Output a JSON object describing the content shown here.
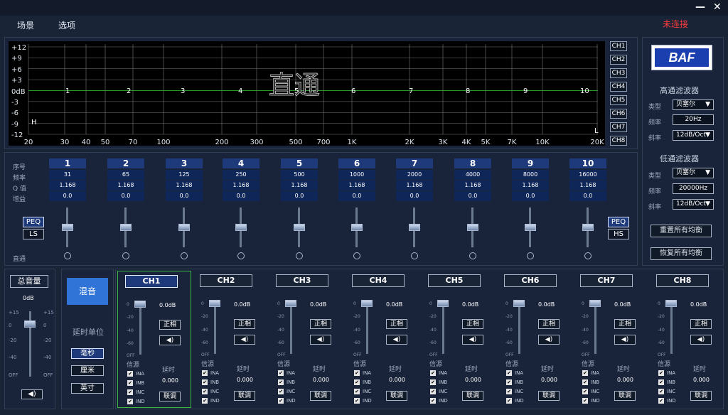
{
  "menu": {
    "items": [
      "场景",
      "选项"
    ],
    "status": "未连接",
    "minimize": "—",
    "close": "✕"
  },
  "graph": {
    "ylabels": [
      "+12",
      "+9",
      "+6",
      "+3",
      "0dB",
      "-3",
      "-6",
      "-9",
      "-12"
    ],
    "xlabels": [
      "20",
      "30",
      "40",
      "50",
      "70",
      "100",
      "200",
      "300",
      "500",
      "700",
      "1K",
      "2K",
      "3K",
      "4K",
      "5K",
      "7K",
      "10K",
      "20K"
    ],
    "band_marks": [
      "1",
      "2",
      "3",
      "4",
      "5",
      "6",
      "7",
      "8",
      "9",
      "10"
    ],
    "overlay": "直通",
    "h_mark": "H",
    "l_mark": "L"
  },
  "channel_tabs": [
    "CH1",
    "CH2",
    "CH3",
    "CH4",
    "CH5",
    "CH6",
    "CH7",
    "CH8"
  ],
  "peq": {
    "row_labels": [
      "序号",
      "频率",
      "Q 值",
      "增益"
    ],
    "bypass_label": "直通",
    "left_buttons": [
      "PEQ",
      "LS"
    ],
    "right_buttons": [
      "PEQ",
      "HS"
    ],
    "bands": [
      {
        "n": "1",
        "freq": "31",
        "q": "1.168",
        "gain": "0.0"
      },
      {
        "n": "2",
        "freq": "65",
        "q": "1.168",
        "gain": "0.0"
      },
      {
        "n": "3",
        "freq": "125",
        "q": "1.168",
        "gain": "0.0"
      },
      {
        "n": "4",
        "freq": "250",
        "q": "1.168",
        "gain": "0.0"
      },
      {
        "n": "5",
        "freq": "500",
        "q": "1.168",
        "gain": "0.0"
      },
      {
        "n": "6",
        "freq": "1000",
        "q": "1.168",
        "gain": "0.0"
      },
      {
        "n": "7",
        "freq": "2000",
        "q": "1.168",
        "gain": "0.0"
      },
      {
        "n": "8",
        "freq": "4000",
        "q": "1.168",
        "gain": "0.0"
      },
      {
        "n": "9",
        "freq": "8000",
        "q": "1.168",
        "gain": "0.0"
      },
      {
        "n": "10",
        "freq": "16000",
        "q": "1.168",
        "gain": "0.0"
      }
    ]
  },
  "right": {
    "logo": "BAF",
    "hp_title": "高通滤波器",
    "lp_title": "低通滤波器",
    "type_label": "类型",
    "freq_label": "频率",
    "slope_label": "斜率",
    "hp_type": "贝塞尔",
    "hp_freq": "20Hz",
    "hp_slope": "12dB/Oct",
    "lp_type": "贝塞尔",
    "lp_freq": "20000Hz",
    "lp_slope": "12dB/Oct",
    "reset_btn": "重置所有均衡",
    "restore_btn": "恢复所有均衡"
  },
  "master": {
    "title": "总音量",
    "value": "0dB",
    "scale_left": [
      "+15",
      "0",
      "-20",
      "-40",
      "OFF"
    ],
    "scale_right": [
      "+15",
      "0",
      "-20",
      "-40",
      "OFF"
    ],
    "mute_icon": "speaker-icon"
  },
  "mix": {
    "button": "混音",
    "delay_unit_label": "延时单位",
    "units": [
      "毫秒",
      "厘米",
      "英寸"
    ]
  },
  "channels": {
    "names": [
      "CH1",
      "CH2",
      "CH3",
      "CH4",
      "CH5",
      "CH6",
      "CH7",
      "CH8"
    ],
    "level": "0.0dB",
    "phase_btn": "正相",
    "source_label": "信源",
    "delay_label": "延时",
    "delay_value": "0.000",
    "link_btn": "联调",
    "inputs": [
      "INA",
      "INB",
      "INC",
      "IND"
    ],
    "scale": [
      "0",
      "-20",
      "-40",
      "-60",
      "OFF"
    ]
  }
}
